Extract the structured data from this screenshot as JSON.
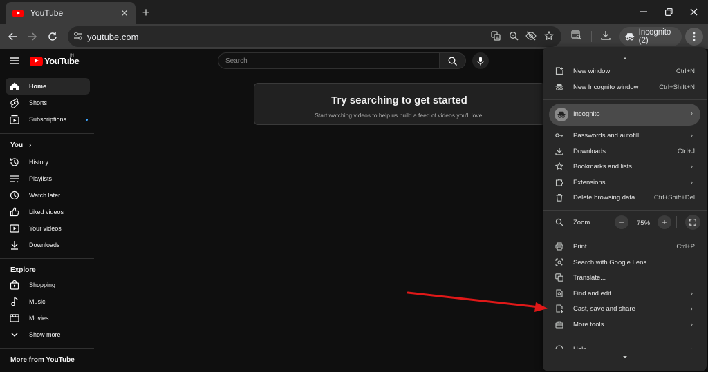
{
  "browser": {
    "tab_title": "YouTube",
    "url": "youtube.com",
    "incognito_label": "Incognito (2)"
  },
  "youtube": {
    "logo_text": "YouTube",
    "region": "IN",
    "search_placeholder": "Search",
    "sidebar": {
      "main": [
        {
          "label": "Home",
          "icon": "home-icon"
        },
        {
          "label": "Shorts",
          "icon": "shorts-icon"
        },
        {
          "label": "Subscriptions",
          "icon": "subscriptions-icon"
        }
      ],
      "you_heading": "You",
      "you_chevron": "›",
      "you": [
        {
          "label": "History",
          "icon": "history-icon"
        },
        {
          "label": "Playlists",
          "icon": "playlists-icon"
        },
        {
          "label": "Watch later",
          "icon": "watch-later-icon"
        },
        {
          "label": "Liked videos",
          "icon": "liked-videos-icon"
        },
        {
          "label": "Your videos",
          "icon": "your-videos-icon"
        },
        {
          "label": "Downloads",
          "icon": "downloads-icon"
        }
      ],
      "explore_heading": "Explore",
      "explore": [
        {
          "label": "Shopping",
          "icon": "shopping-icon"
        },
        {
          "label": "Music",
          "icon": "music-icon"
        },
        {
          "label": "Movies",
          "icon": "movies-icon"
        },
        {
          "label": "Show more",
          "icon": "chevron-down-icon"
        }
      ],
      "more_heading": "More from YouTube"
    },
    "empty_state": {
      "title": "Try searching to get started",
      "subtitle": "Start watching videos to help us build a feed of videos you'll love."
    }
  },
  "menu": {
    "new_window": {
      "label": "New window",
      "shortcut": "Ctrl+N"
    },
    "new_incognito": {
      "label": "New Incognito window",
      "shortcut": "Ctrl+Shift+N"
    },
    "incognito": {
      "label": "Incognito"
    },
    "passwords": {
      "label": "Passwords and autofill"
    },
    "downloads": {
      "label": "Downloads",
      "shortcut": "Ctrl+J"
    },
    "bookmarks": {
      "label": "Bookmarks and lists"
    },
    "extensions": {
      "label": "Extensions"
    },
    "delete_browsing": {
      "label": "Delete browsing data...",
      "shortcut": "Ctrl+Shift+Del"
    },
    "zoom": {
      "label": "Zoom",
      "value": "75%",
      "minus": "−",
      "plus": "+"
    },
    "print": {
      "label": "Print...",
      "shortcut": "Ctrl+P"
    },
    "lens": {
      "label": "Search with Google Lens"
    },
    "translate": {
      "label": "Translate..."
    },
    "find_edit": {
      "label": "Find and edit"
    },
    "cast_save": {
      "label": "Cast, save and share"
    },
    "more_tools": {
      "label": "More tools"
    },
    "help": {
      "label": "Help"
    }
  },
  "colors": {
    "annotation_arrow": "#e01818",
    "youtube_red": "#ff0000",
    "menu_bg": "#282828"
  }
}
